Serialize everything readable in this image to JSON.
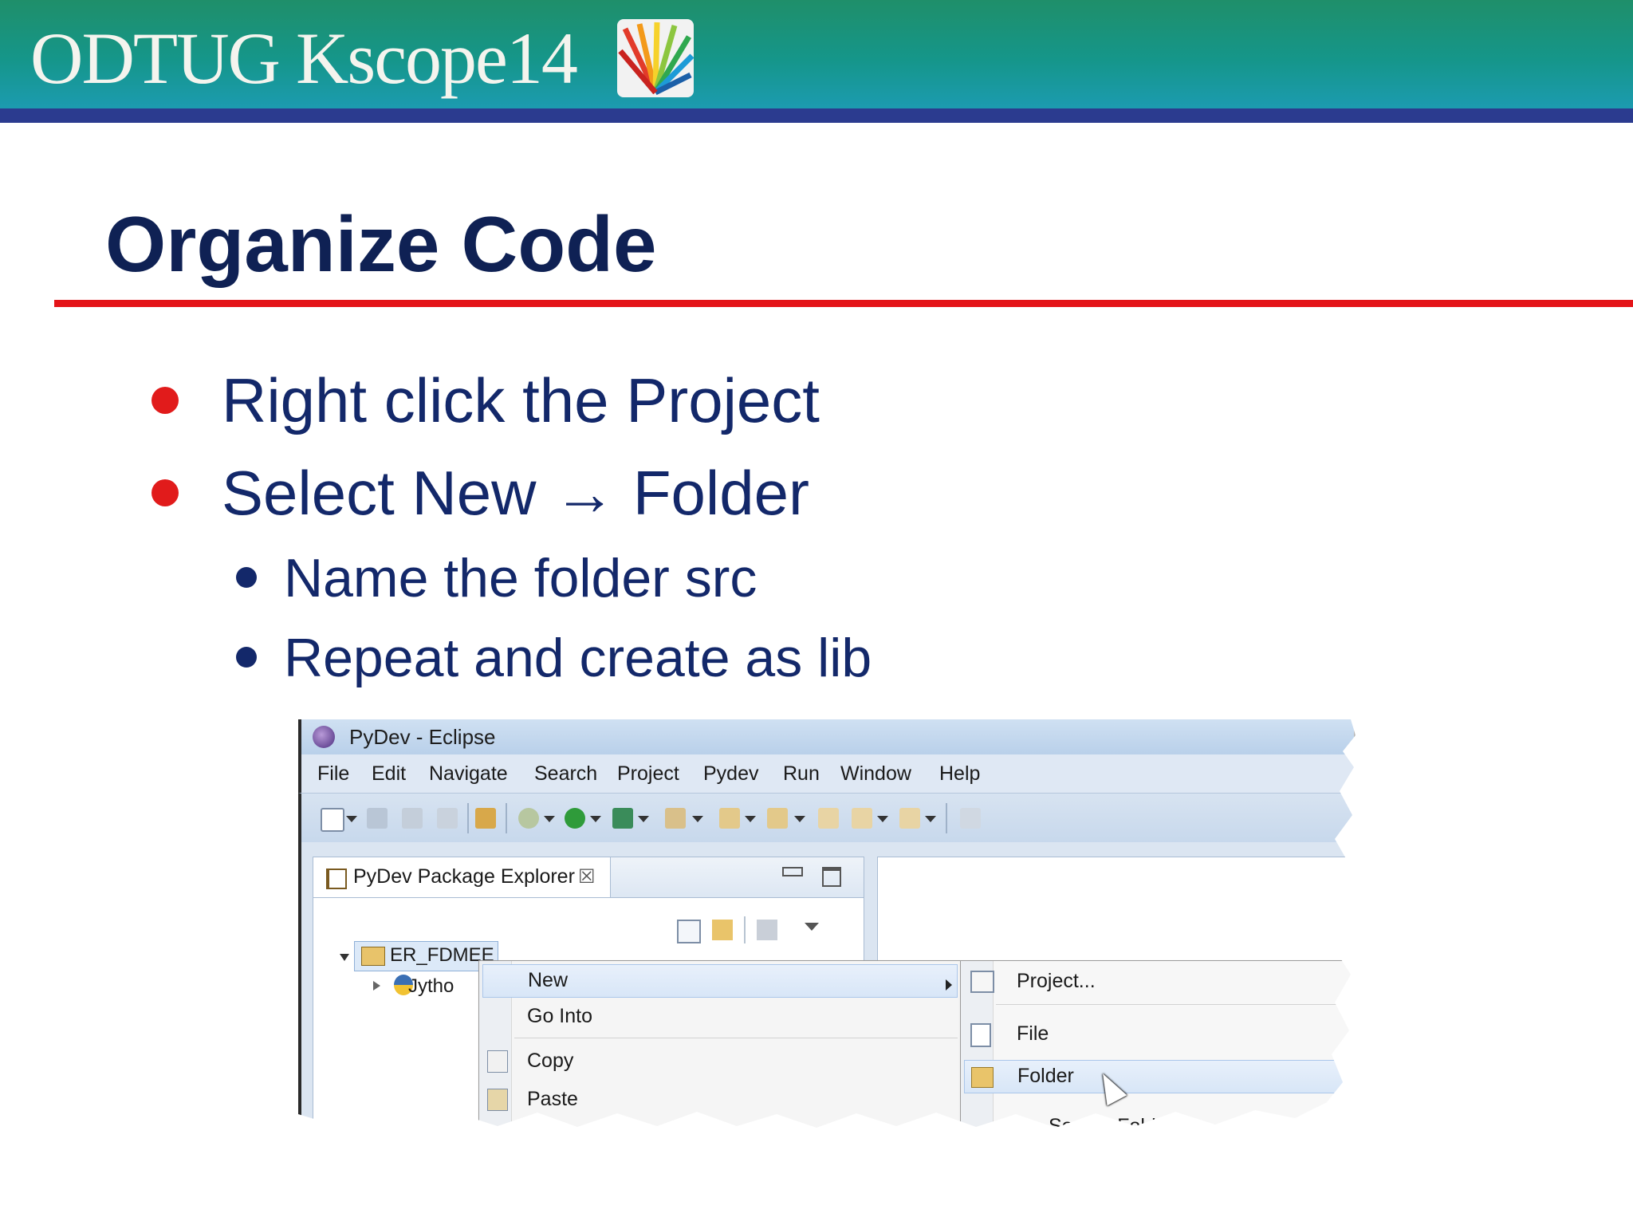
{
  "header": {
    "logo_text": "ODTUG Kscope14"
  },
  "slide": {
    "title": "Organize Code",
    "bullets": [
      "Right click the Project",
      "Select New → Folder"
    ],
    "sub_bullets": [
      "Name the folder src",
      "Repeat and create as lib"
    ]
  },
  "eclipse": {
    "window_title": "PyDev - Eclipse",
    "menu": [
      "File",
      "Edit",
      "Navigate",
      "Search",
      "Project",
      "Pydev",
      "Run",
      "Window",
      "Help"
    ],
    "package_explorer": {
      "tab_label": "PyDev Package Explorer",
      "close_glyph": "☒",
      "tree": {
        "project": "ER_FDMEE",
        "child": "Jytho"
      }
    },
    "context_menu": {
      "items": [
        "New",
        "Go Into",
        "Copy",
        "Paste"
      ]
    },
    "submenu": {
      "items": [
        "Project...",
        "File",
        "Folder"
      ],
      "partial_item": "Source Folder"
    }
  },
  "colors": {
    "title": "#0f2154",
    "accent_red": "#e41418",
    "banner_green": "#1f8f6a",
    "banner_rule": "#2b3b8f"
  }
}
